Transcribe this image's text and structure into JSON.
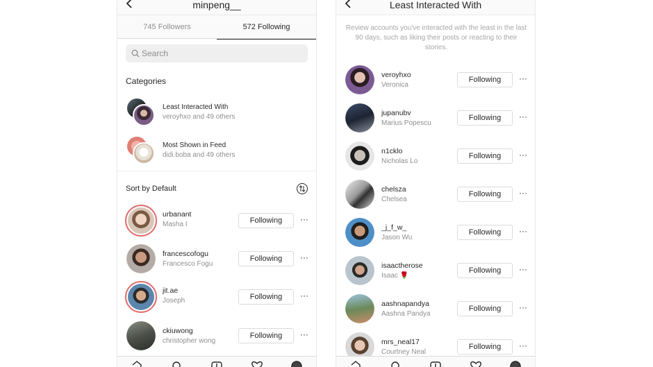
{
  "left": {
    "title": "minpeng__",
    "tabs": [
      "745 Followers",
      "572 Following"
    ],
    "search_placeholder": "Search",
    "categories_label": "Categories",
    "categories": [
      {
        "title": "Least Interacted With",
        "subtitle": "veroyhxo and 49 others"
      },
      {
        "title": "Most Shown in Feed",
        "subtitle": "didi.boba and 49 others"
      }
    ],
    "sort_prefix": "Sort by ",
    "sort_value": "Default",
    "following": [
      {
        "username": "urbanant",
        "name": "Masha I",
        "button": "Following"
      },
      {
        "username": "francescofogu",
        "name": "Francesco Fogu",
        "button": "Following"
      },
      {
        "username": "jit.ae",
        "name": "Joseph",
        "button": "Following"
      },
      {
        "username": "ckiuwong",
        "name": "christopher wong",
        "button": "Following"
      }
    ]
  },
  "right": {
    "title": "Least Interacted With",
    "description": "Review accounts you've interacted with the least in the last 90 days, such as liking their posts or reacting to their stories.",
    "accounts": [
      {
        "username": "veroyhxo",
        "name": "Veronica",
        "button": "Following"
      },
      {
        "username": "jupanubv",
        "name": "Marius Popescu",
        "button": "Following"
      },
      {
        "username": "n1cklo",
        "name": "Nicholas Lo",
        "button": "Following"
      },
      {
        "username": "chelsza",
        "name": "Chelsea",
        "button": "Following"
      },
      {
        "username": "_j_f_w_",
        "name": "Jason Wu",
        "button": "Following"
      },
      {
        "username": "isaactherose",
        "name": "Isaac 🌹",
        "button": "Following"
      },
      {
        "username": "aashnapandya",
        "name": "Aashna Pandya",
        "button": "Following"
      },
      {
        "username": "mrs_neal17",
        "name": "Courtney Neal",
        "button": "Following"
      }
    ]
  },
  "colors": {
    "story_ring": "#e36c6c",
    "text": "#262626",
    "muted": "#8e8e8e",
    "border": "#dbdbdb"
  }
}
